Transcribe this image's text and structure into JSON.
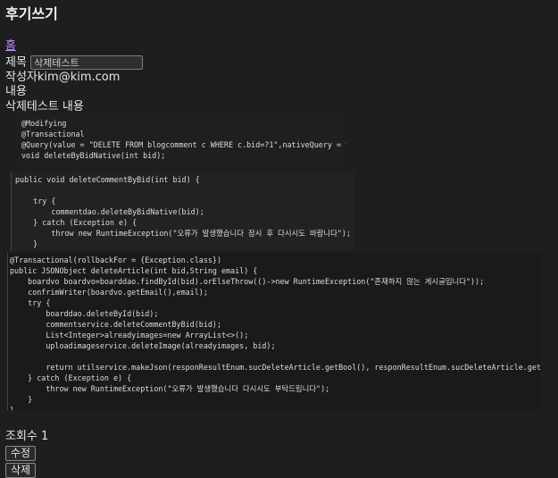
{
  "page_title": "후기쓰기",
  "home_link": "홈",
  "title_label": "제목",
  "title_value": "삭제테스트",
  "author_label": "작성자",
  "author_value": "kim@kim.com",
  "content_label": "내용",
  "content_text": "삭제테스트 내용",
  "code_blocks": [
    "@Modifying\n@Transactional\n@Query(value = \"DELETE FROM blogcomment c WHERE c.bid=?1\",nativeQuery = true) ,\nvoid deleteByBidNative(int bid);",
    "public void deleteCommentByBid(int bid) {\n\n    try {\n        commentdao.deleteByBidNative(bid);\n    } catch (Exception e) {\n        throw new RuntimeException(\"오류가 발생했습니다 잠시 후 다시시도 바랍니다\");\n    }\n}",
    "@Transactional(rollbackFor = {Exception.class})\npublic JSONObject deleteArticle(int bid,String email) {\n    boardvo boardvo=boarddao.findById(bid).orElseThrow(()->new RuntimeException(\"존재하지 않는 게시글입니다\"));\n    confrimWriter(boardvo.getEmail(),email);\n    try {\n        boarddao.deleteById(bid);\n        commentservice.deleteCommentByBid(bid);\n        List<Integer>alreadyimages=new ArrayList<>();\n        uploadimageservice.deleteImage(alreadyimages, bid);\n\n        return utilservice.makeJson(responResultEnum.sucDeleteArticle.getBool(), responResultEnum.sucDeleteArticle.getMessege());\n    } catch (Exception e) {\n        throw new RuntimeException(\"오류가 발생했습니다 다시시도 부탁드립니다\");\n    }\n}"
  ],
  "views_label": "조회수",
  "views_value": "1",
  "edit_button": "수정",
  "delete_button": "삭제"
}
